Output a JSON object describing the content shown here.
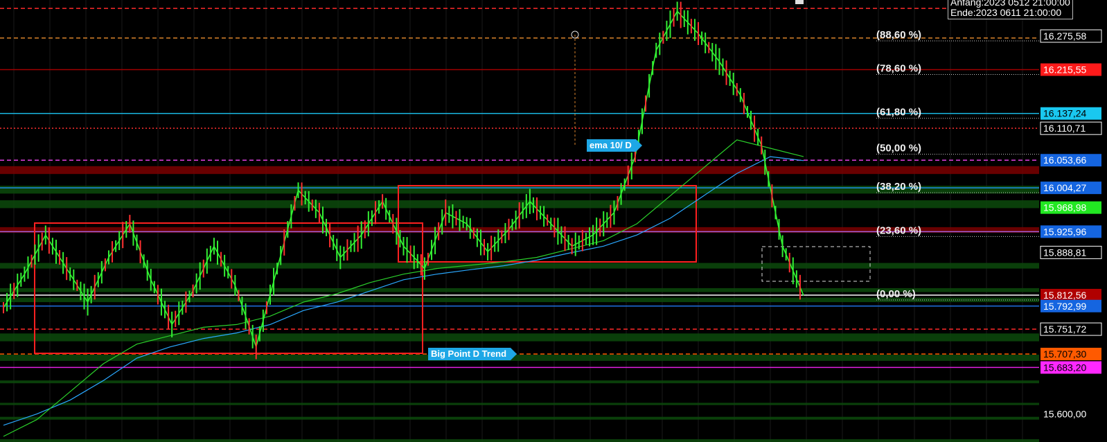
{
  "header": {
    "start_label": "Anfang:2023 0512 21:00:00",
    "end_label": "Ende:2023 0611 21:00:00"
  },
  "indicator_tags": [
    {
      "text": "ema 10/ D",
      "color": "#1ea7e6"
    },
    {
      "text": "Big Point D Trend",
      "color": "#1ea7e6"
    }
  ],
  "chart_data": {
    "type": "line",
    "title": "",
    "xlabel": "",
    "ylabel": "",
    "ylim": [
      15550,
      16340
    ],
    "grid": true,
    "fib_levels": [
      {
        "label": "(88,60 %)",
        "price": 16275.58
      },
      {
        "label": "(78,60 %)",
        "price": 16215.55
      },
      {
        "label": "(61,80 %)",
        "price": 16137.24
      },
      {
        "label": "(50,00 %)",
        "price": 16073.0
      },
      {
        "label": "(38,20 %)",
        "price": 16004.27
      },
      {
        "label": "(23,60 %)",
        "price": 15925.96
      },
      {
        "label": "(0,00 %)",
        "price": 15812.56
      }
    ],
    "price_labels": [
      {
        "text": "16.275,58",
        "price": 16275.58,
        "bg": "#000000",
        "fg": "#ffffff",
        "border": "#ffffff"
      },
      {
        "text": "16.215,55",
        "price": 16215.55,
        "bg": "#ff1a1a",
        "fg": "#ffffff",
        "border": ""
      },
      {
        "text": "16.137,24",
        "price": 16137.24,
        "bg": "#19c8f0",
        "fg": "#000000",
        "border": ""
      },
      {
        "text": "16.110,71",
        "price": 16110.71,
        "bg": "#000000",
        "fg": "#ffffff",
        "border": "#ffffff"
      },
      {
        "text": "16.053,66",
        "price": 16053.66,
        "bg": "#1565e0",
        "fg": "#ffffff",
        "border": ""
      },
      {
        "text": "16.004,27",
        "price": 16004.27,
        "bg": "#1565e0",
        "fg": "#ffffff",
        "border": ""
      },
      {
        "text": "15.968,98",
        "price": 15968.98,
        "bg": "#22e822",
        "fg": "#ffffff",
        "border": ""
      },
      {
        "text": "15.925,96",
        "price": 15925.96,
        "bg": "#1565e0",
        "fg": "#ffffff",
        "border": ""
      },
      {
        "text": "15.888,81",
        "price": 15888.81,
        "bg": "#000000",
        "fg": "#ffffff",
        "border": "#ffffff"
      },
      {
        "text": "15.812,56",
        "price": 15812.56,
        "bg": "#b00000",
        "fg": "#ffffff",
        "border": ""
      },
      {
        "text": "15.792,99",
        "price": 15792.99,
        "bg": "#1565e0",
        "fg": "#ffffff",
        "border": ""
      },
      {
        "text": "15.751,72",
        "price": 15751.72,
        "bg": "#000000",
        "fg": "#ffffff",
        "border": "#ffffff"
      },
      {
        "text": "15.707,30",
        "price": 15707.3,
        "bg": "#ff5a00",
        "fg": "#000000",
        "border": ""
      },
      {
        "text": "15.683,20",
        "price": 15683.2,
        "bg": "#ff28ff",
        "fg": "#000000",
        "border": ""
      },
      {
        "text": "15.600,00",
        "price": 15600.0,
        "bg": "none",
        "fg": "#ffffff",
        "border": ""
      }
    ],
    "horizontal_levels": [
      {
        "price": 16325,
        "style": "dashed",
        "color": "#ff2a2a"
      },
      {
        "price": 16272,
        "style": "dashed",
        "color": "#d9822b"
      },
      {
        "price": 16215.55,
        "style": "solid",
        "color": "#a00000"
      },
      {
        "price": 16137.24,
        "style": "solid",
        "color": "#19b6e0"
      },
      {
        "price": 16110.71,
        "style": "dotted",
        "color": "#ff3030"
      },
      {
        "price": 16053.66,
        "style": "dashed",
        "color": "#e040e0"
      },
      {
        "price": 16004.27,
        "style": "solid",
        "color": "#1e8ce8"
      },
      {
        "price": 15925.96,
        "style": "solid",
        "color": "#a060e0"
      },
      {
        "price": 15812.56,
        "style": "solid",
        "color": "#ffffff"
      },
      {
        "price": 15792.99,
        "style": "solid",
        "color": "#1e70e0"
      },
      {
        "price": 15751.72,
        "style": "dashed",
        "color": "#ff2a2a"
      },
      {
        "price": 15707.3,
        "style": "dashed",
        "color": "#ff5a00"
      },
      {
        "price": 15683.2,
        "style": "solid",
        "color": "#e020e0"
      }
    ],
    "zones": [
      {
        "from": 16043,
        "to": 16029,
        "color": "#7a0000"
      },
      {
        "from": 16008,
        "to": 15994,
        "color": "#0c4a0c"
      },
      {
        "from": 15982,
        "to": 15968,
        "color": "#0c4a0c"
      },
      {
        "from": 15934,
        "to": 15924,
        "color": "#7a0000"
      },
      {
        "from": 15870,
        "to": 15860,
        "color": "#0c4a0c"
      },
      {
        "from": 15825,
        "to": 15818,
        "color": "#0c4a0c"
      },
      {
        "from": 15808,
        "to": 15800,
        "color": "#0c4a0c"
      },
      {
        "from": 15744,
        "to": 15730,
        "color": "#0c4a0c"
      },
      {
        "from": 15706,
        "to": 15695,
        "color": "#0c4a0c"
      },
      {
        "from": 15660,
        "to": 15655,
        "color": "#0c4a0c"
      },
      {
        "from": 15620,
        "to": 15616,
        "color": "#0c4a0c"
      },
      {
        "from": 15595,
        "to": 15590,
        "color": "#0c4a0c"
      },
      {
        "from": 15555,
        "to": 15550,
        "color": "#0c4a0c"
      }
    ],
    "series": [
      {
        "name": "",
        "color": "#2aa8ff",
        "values": [
          15580,
          15600,
          15625,
          15660,
          15700,
          15720,
          15735,
          15745,
          15760,
          15785,
          15800,
          15820,
          15840,
          15850,
          15858,
          15865,
          15875,
          15888,
          15900,
          15920,
          15950,
          15990,
          16030,
          16060,
          16053
        ]
      },
      {
        "name": "",
        "color": "#2bd02b",
        "values": [
          15560,
          15590,
          15640,
          15690,
          15725,
          15740,
          15755,
          15760,
          15775,
          15800,
          15815,
          15835,
          15850,
          15860,
          15866,
          15872,
          15880,
          15895,
          15910,
          15940,
          15990,
          16040,
          16090,
          16075,
          16060
        ]
      },
      {
        "name": "",
        "color": "#33ff33",
        "values": [
          15790,
          15850,
          15920,
          15860,
          15800,
          15880,
          15940,
          15840,
          15760,
          15820,
          15900,
          15830,
          15720,
          15860,
          16000,
          15960,
          15880,
          15920,
          15980,
          15900,
          15860,
          15960,
          15940,
          15890,
          15930,
          15980,
          15940,
          15900,
          15920,
          15960,
          16060,
          16250,
          16320,
          16280,
          16230,
          16170,
          16080,
          15900,
          15812
        ]
      }
    ]
  }
}
